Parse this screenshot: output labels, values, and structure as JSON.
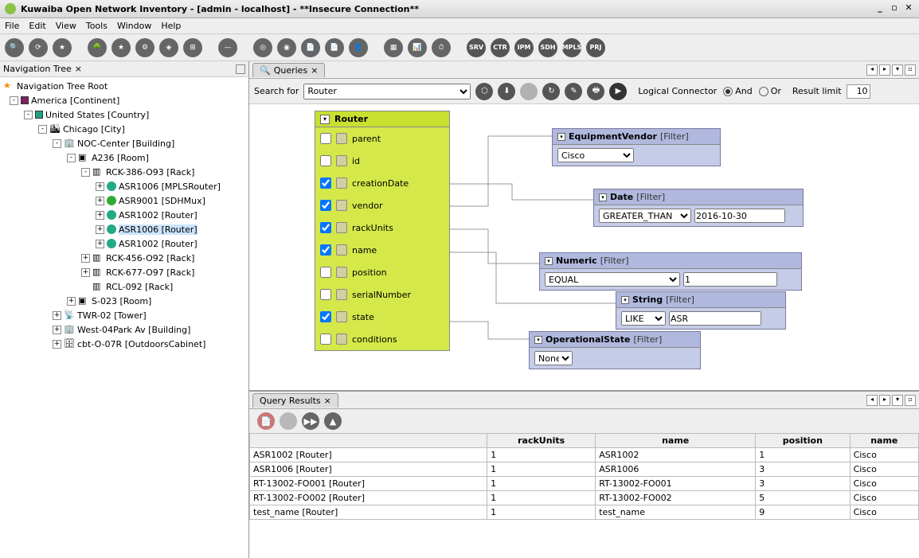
{
  "window": {
    "title": "Kuwaiba Open Network Inventory - [admin - localhost] - **Insecure Connection**"
  },
  "menu": {
    "items": [
      "File",
      "Edit",
      "View",
      "Tools",
      "Window",
      "Help"
    ]
  },
  "toolbar_icons": [
    "🔍",
    "⟳",
    "★",
    " ",
    "🌳",
    "★",
    "⚙",
    "◈",
    "⊞",
    " ",
    "—",
    " ",
    "◎",
    "◉",
    "📄",
    "📄",
    "👤",
    " ",
    "▦",
    "📊",
    "⏱",
    " "
  ],
  "toolbar_labeled": [
    "SRV",
    "CTR",
    "IPM",
    "SDH",
    "MPLS",
    "PRJ"
  ],
  "nav": {
    "title": "Navigation Tree",
    "root": "Navigation Tree Root",
    "items": [
      {
        "depth": 0,
        "tog": "-",
        "icon": "sq1",
        "label": "America [Continent]"
      },
      {
        "depth": 1,
        "tog": "-",
        "icon": "sq2",
        "label": "United States [Country]"
      },
      {
        "depth": 2,
        "tog": "-",
        "icon": "city",
        "glyph": "🏙",
        "label": "Chicago [City]"
      },
      {
        "depth": 3,
        "tog": "-",
        "icon": "bldg",
        "glyph": "🏢",
        "label": "NOC-Center [Building]"
      },
      {
        "depth": 4,
        "tog": "-",
        "icon": "room",
        "glyph": "▣",
        "label": "A236 [Room]"
      },
      {
        "depth": 5,
        "tog": "-",
        "icon": "rack",
        "glyph": "▥",
        "label": "RCK-386-O93 [Rack]"
      },
      {
        "depth": 6,
        "tog": "+",
        "icon": "router",
        "label": "ASR1006 [MPLSRouter]"
      },
      {
        "depth": 6,
        "tog": "+",
        "icon": "sdh",
        "label": "ASR9001 [SDHMux]"
      },
      {
        "depth": 6,
        "tog": "+",
        "icon": "router",
        "label": "ASR1002 [Router]"
      },
      {
        "depth": 6,
        "tog": "+",
        "icon": "router",
        "label": "ASR1006 [Router]",
        "sel": true
      },
      {
        "depth": 6,
        "tog": "+",
        "icon": "router",
        "label": "ASR1002 [Router]"
      },
      {
        "depth": 5,
        "tog": "+",
        "icon": "rack",
        "glyph": "▥",
        "label": "RCK-456-O92 [Rack]"
      },
      {
        "depth": 5,
        "tog": "+",
        "icon": "rack",
        "glyph": "▥",
        "label": "RCK-677-O97 [Rack]"
      },
      {
        "depth": 5,
        "tog": "",
        "icon": "rack",
        "glyph": "▥",
        "label": "RCL-092 [Rack]"
      },
      {
        "depth": 4,
        "tog": "+",
        "icon": "room",
        "glyph": "▣",
        "label": "S-023 [Room]"
      },
      {
        "depth": 3,
        "tog": "+",
        "icon": "bldg",
        "glyph": "📡",
        "label": "TWR-02 [Tower]"
      },
      {
        "depth": 3,
        "tog": "+",
        "icon": "bldg",
        "glyph": "🏢",
        "label": "West-04Park Av [Building]"
      },
      {
        "depth": 3,
        "tog": "+",
        "icon": "bldg",
        "glyph": "🗄",
        "label": "cbt-O-07R [OutdoorsCabinet]"
      }
    ]
  },
  "queries": {
    "tab": "Queries",
    "search_label": "Search for",
    "search_value": "Router",
    "connector_label": "Logical Connector",
    "and_label": "And",
    "or_label": "Or",
    "limit_label": "Result limit",
    "limit_value": "10",
    "classbox": {
      "title": "Router",
      "attrs": [
        {
          "checked": false,
          "name": "parent"
        },
        {
          "checked": false,
          "name": "id"
        },
        {
          "checked": true,
          "name": "creationDate"
        },
        {
          "checked": true,
          "name": "vendor"
        },
        {
          "checked": true,
          "name": "rackUnits"
        },
        {
          "checked": true,
          "name": "name"
        },
        {
          "checked": false,
          "name": "position"
        },
        {
          "checked": false,
          "name": "serialNumber"
        },
        {
          "checked": true,
          "name": "state"
        },
        {
          "checked": false,
          "name": "conditions"
        }
      ]
    },
    "filters": {
      "vendor": {
        "title": "EquipmentVendor",
        "tag": "[Filter]",
        "value": "Cisco"
      },
      "date": {
        "title": "Date",
        "tag": "[Filter]",
        "op": "GREATER_THAN",
        "value": "2016-10-30"
      },
      "numeric": {
        "title": "Numeric",
        "tag": "[Filter]",
        "op": "EQUAL",
        "value": "1"
      },
      "string": {
        "title": "String",
        "tag": "[Filter]",
        "op": "LIKE",
        "value": "ASR"
      },
      "opstate": {
        "title": "OperationalState",
        "tag": "[Filter]",
        "value": "None"
      }
    }
  },
  "results": {
    "title": "Query Results",
    "columns": [
      "",
      "rackUnits",
      "name",
      "position",
      "name"
    ],
    "rows": [
      [
        "ASR1002 [Router]",
        "1",
        "ASR1002",
        "1",
        "Cisco"
      ],
      [
        "ASR1006 [Router]",
        "1",
        "ASR1006",
        "3",
        "Cisco"
      ],
      [
        "RT-13002-FO001 [Router]",
        "1",
        "RT-13002-FO001",
        "3",
        "Cisco"
      ],
      [
        "RT-13002-FO002 [Router]",
        "1",
        "RT-13002-FO002",
        "5",
        "Cisco"
      ],
      [
        "test_name [Router]",
        "1",
        "test_name",
        "9",
        "Cisco"
      ]
    ]
  }
}
